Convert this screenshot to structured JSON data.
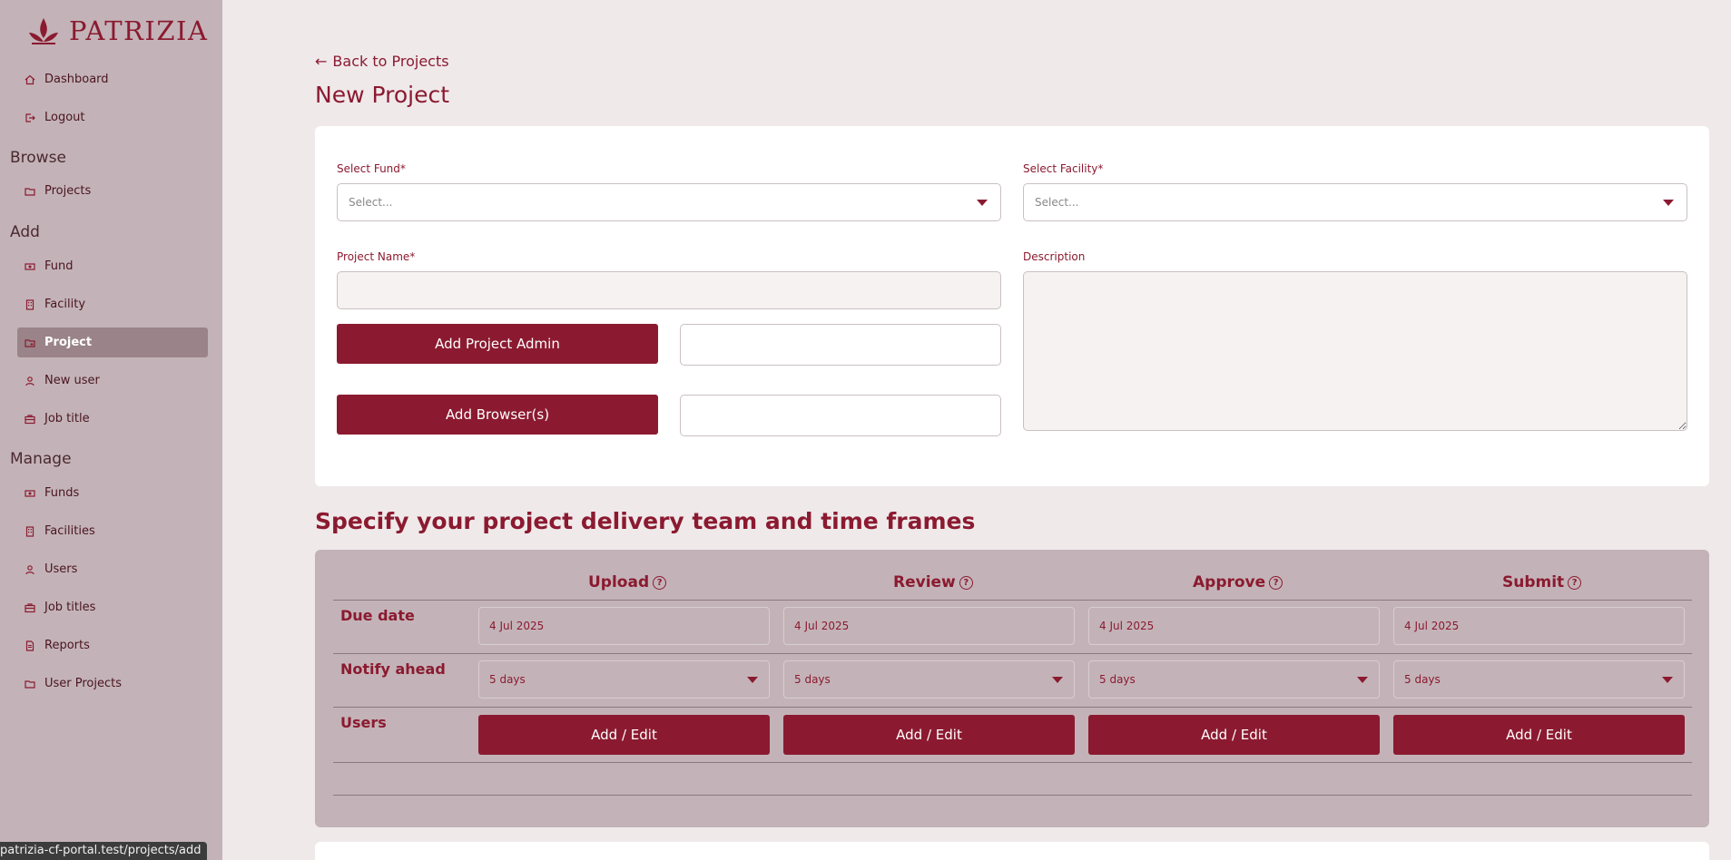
{
  "brand": {
    "name": "PATRIZIA"
  },
  "sidebar": {
    "top_items": [
      {
        "label": "Dashboard",
        "icon": "home-icon"
      },
      {
        "label": "Logout",
        "icon": "logout-icon"
      }
    ],
    "sections": [
      {
        "title": "Browse",
        "items": [
          {
            "label": "Projects",
            "icon": "folder-icon"
          }
        ]
      },
      {
        "title": "Add",
        "items": [
          {
            "label": "Fund",
            "icon": "money-icon"
          },
          {
            "label": "Facility",
            "icon": "building-icon"
          },
          {
            "label": "Project",
            "icon": "folder-plus-icon",
            "active": true
          },
          {
            "label": "New user",
            "icon": "user-icon"
          },
          {
            "label": "Job title",
            "icon": "briefcase-icon"
          }
        ]
      },
      {
        "title": "Manage",
        "items": [
          {
            "label": "Funds",
            "icon": "money-icon"
          },
          {
            "label": "Facilities",
            "icon": "building-icon"
          },
          {
            "label": "Users",
            "icon": "user-icon"
          },
          {
            "label": "Job titles",
            "icon": "briefcase-icon"
          },
          {
            "label": "Reports",
            "icon": "document-icon"
          },
          {
            "label": "User Projects",
            "icon": "folder-icon"
          }
        ]
      }
    ]
  },
  "status_url": "patrizia-cf-portal.test/projects/add",
  "main": {
    "back_link": "Back to Projects",
    "page_title": "New Project",
    "form": {
      "fund_label": "Select Fund*",
      "fund_placeholder": "Select...",
      "facility_label": "Select Facility*",
      "facility_placeholder": "Select...",
      "project_name_label": "Project Name*",
      "project_name_value": "",
      "description_label": "Description",
      "description_value": "",
      "add_admin_button": "Add Project Admin",
      "add_browser_button": "Add Browser(s)"
    },
    "team": {
      "section_title": "Specify your project delivery team and time frames",
      "columns": [
        "Upload",
        "Review",
        "Approve",
        "Submit"
      ],
      "row_labels": {
        "due_date": "Due date",
        "notify": "Notify ahead",
        "users": "Users"
      },
      "due_dates": [
        "4 Jul 2025",
        "4 Jul 2025",
        "4 Jul 2025",
        "4 Jul 2025"
      ],
      "notify_values": [
        "5 days",
        "5 days",
        "5 days",
        "5 days"
      ],
      "users_button": "Add / Edit",
      "help_glyph": "?"
    }
  },
  "colors": {
    "accent": "#8b1a30",
    "sidebar_bg": "#c3b3b8",
    "page_bg": "#efe9ea"
  }
}
